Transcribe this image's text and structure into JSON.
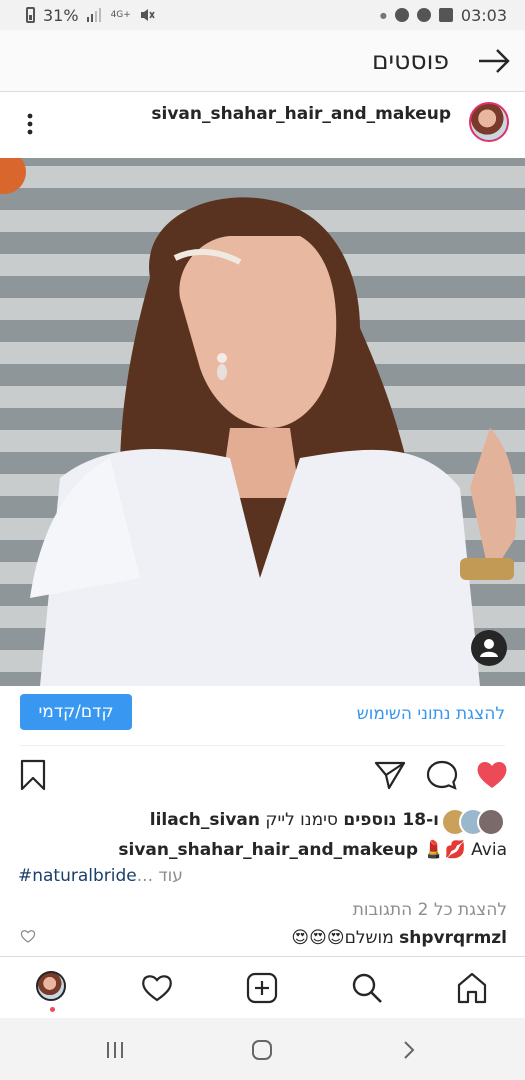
{
  "status_bar": {
    "battery": "31%",
    "network": "4G+",
    "time": "03:03"
  },
  "header": {
    "title": "פוסטים",
    "back_icon": "arrow-right-icon"
  },
  "post": {
    "username": "sivan_shahar_hair_and_makeup",
    "menu_icon": "more-vertical-icon"
  },
  "insights": {
    "promote_label": "קדם/קדמי",
    "view_insights_label": "להצגת נתוני השימוש"
  },
  "actions": {
    "like_icon": "heart-filled-icon",
    "comment_icon": "comment-icon",
    "share_icon": "send-icon",
    "save_icon": "bookmark-icon"
  },
  "likes": {
    "first_liker": "lilach_sivan",
    "text": "סימנו לייק",
    "others": "ו-18 נוספים"
  },
  "caption": {
    "username": "sivan_shahar_hair_and_makeup",
    "text": "💄💋 Avia",
    "hashtag": "#naturalbride",
    "more": "... עוד"
  },
  "comments": {
    "view_all": "להצגת כל 2 התגובות",
    "comment_user": "shpvrqrmzl",
    "comment_text": "מושלם😍😍😍"
  },
  "bottom_nav": {
    "items": [
      "profile-icon",
      "activity-heart-icon",
      "new-post-icon",
      "search-icon",
      "home-icon"
    ]
  },
  "colors": {
    "accent": "#3897f0",
    "like_red": "#ed4956",
    "hashtag": "#1a3f6b"
  }
}
